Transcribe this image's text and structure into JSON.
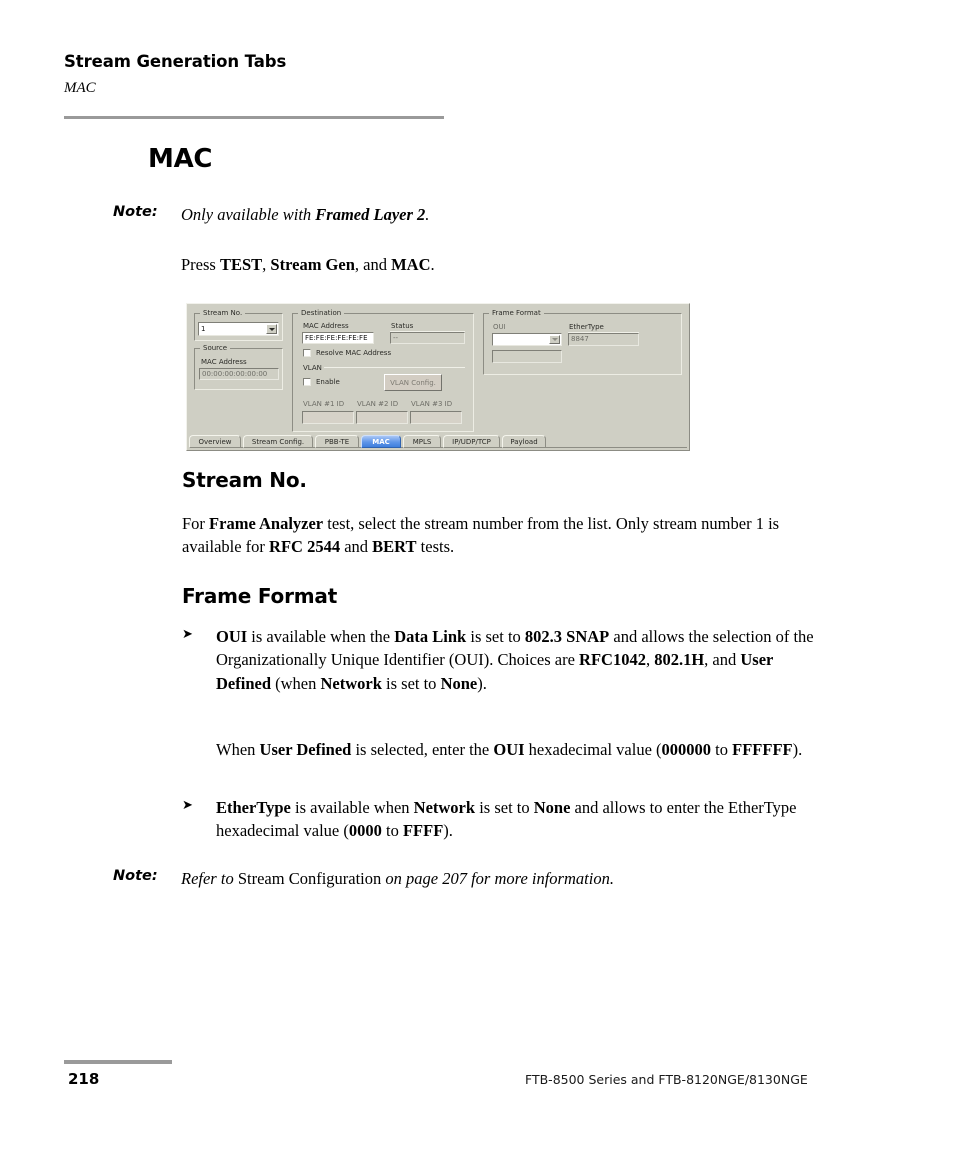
{
  "runhead": {
    "title": "Stream Generation Tabs",
    "subtitle": "MAC"
  },
  "page": {
    "heading": "MAC"
  },
  "note_1": {
    "label": "Note:",
    "text_1": "Only available with ",
    "bold_1": "Framed Layer 2",
    "text_2": "."
  },
  "press_line": {
    "t1": "Press ",
    "b1": "TEST",
    "t2": ", ",
    "b2": "Stream Gen",
    "t3": ", and ",
    "b3": "MAC",
    "t4": "."
  },
  "stream_no": {
    "heading": "Stream No.",
    "t1": "For ",
    "b1": "Frame Analyzer",
    "t2": " test, select the stream number from the list. Only stream number 1 is available for ",
    "b2": "RFC 2544",
    "t3": " and ",
    "b3": "BERT",
    "t4": " tests."
  },
  "frame_format": {
    "heading": "Frame Format",
    "bullet_mark": "➤",
    "bullet_1": {
      "b1": "OUI",
      "t1": " is available when the ",
      "b2": "Data Link",
      "t2": " is set to ",
      "b3": "802.3 SNAP",
      "t3": " and allows the selection of the Organizationally Unique Identifier (OUI). Choices are ",
      "b4": "RFC1042",
      "t4": ", ",
      "b5": "802.1H",
      "t5": ", and ",
      "b6": "User Defined",
      "t6": " (when ",
      "b7": "Network",
      "t7": " is set to ",
      "b8": "None",
      "t8": ")."
    },
    "sub_para_1": {
      "t1": "When ",
      "b1": "User Defined",
      "t2": " is selected, enter the ",
      "b2": "OUI",
      "t3": " hexadecimal value (",
      "b3": "000000",
      "t4": " to ",
      "b4": "FFFFFF",
      "t5": ")."
    },
    "bullet_2": {
      "b1": "EtherType",
      "t1": " is available when ",
      "b2": "Network",
      "t2": " is set to ",
      "b3": "None",
      "t3": " and allows to enter the EtherType hexadecimal value (",
      "b4": "0000",
      "t4": " to ",
      "b5": "FFFF",
      "t5": ")."
    }
  },
  "note_2": {
    "label": "Note:",
    "t1": "Refer to ",
    "roman": "Stream Configuration",
    "t2": " on page 207 for more information."
  },
  "footer": {
    "page_number": "218",
    "product": "FTB-8500 Series and FTB-8120NGE/8130NGE"
  },
  "screenshot": {
    "stream_no_group": {
      "title": "Stream No.",
      "combo_value": "1"
    },
    "source_group": {
      "title": "Source",
      "mac_label": "MAC Address",
      "mac_value": "00:00:00:00:00:00"
    },
    "destination_group": {
      "title": "Destination",
      "mac_label": "MAC Address",
      "mac_value": "FE:FE:FE:FE:FE:FE",
      "status_label": "Status",
      "status_value": "--",
      "resolve_label": "Resolve MAC Address",
      "resolve_checked": false,
      "vlan_title": "VLAN",
      "vlan_enable_label": "Enable",
      "vlan_enable_checked": false,
      "vlan_config_button": "VLAN Config.",
      "vlan1_label": "VLAN #1 ID",
      "vlan1_value": "",
      "vlan2_label": "VLAN #2 ID",
      "vlan2_value": "",
      "vlan3_label": "VLAN #3 ID",
      "vlan3_value": ""
    },
    "frame_format_group": {
      "title": "Frame Format",
      "oui_label": "OUI",
      "oui_value": "",
      "oui_user_value": "",
      "ethertype_label": "EtherType",
      "ethertype_value": "8847"
    },
    "tabs": [
      {
        "label": "Overview",
        "active": false
      },
      {
        "label": "Stream Config.",
        "active": false
      },
      {
        "label": "PBB-TE",
        "active": false
      },
      {
        "label": "MAC",
        "active": true
      },
      {
        "label": "MPLS",
        "active": false
      },
      {
        "label": "IP/UDP/TCP",
        "active": false
      },
      {
        "label": "Payload",
        "active": false
      }
    ],
    "colors": {
      "panel": "#cfcfc4",
      "active_tab": "#5f96e8",
      "field": "#ffffff"
    }
  }
}
